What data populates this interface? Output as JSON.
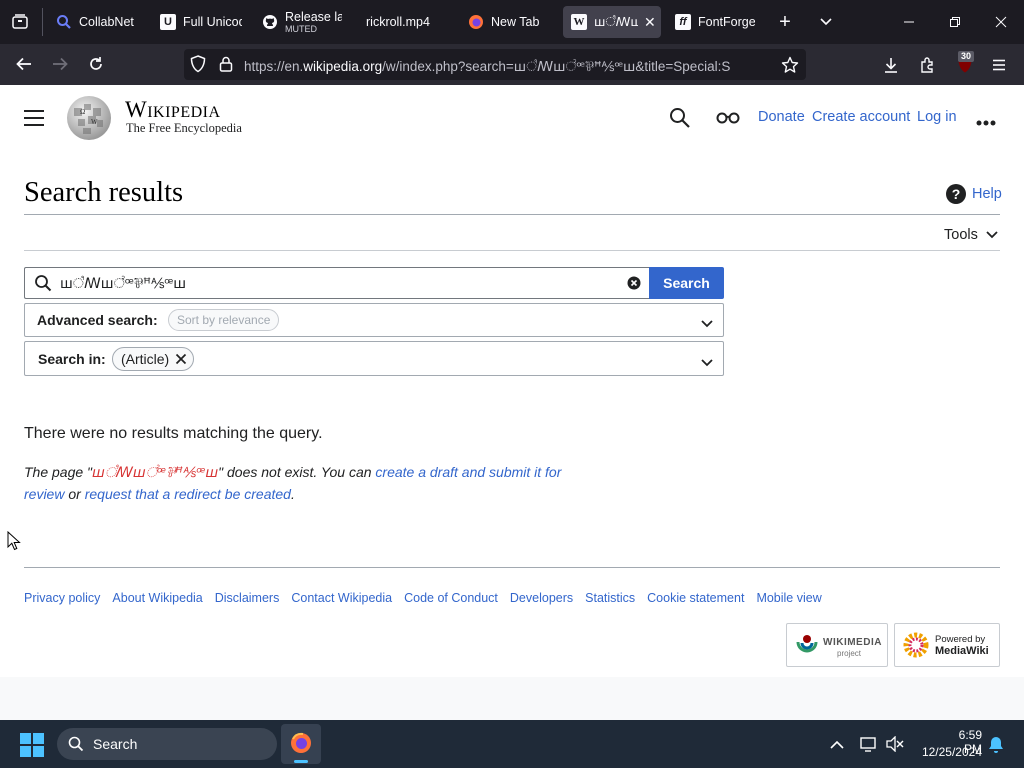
{
  "browser": {
    "tabs": [
      {
        "label": "CollabNet",
        "icon": "search-icon",
        "active": false
      },
      {
        "label": "Full Unicode",
        "icon": "unicode-favicon",
        "active": false
      },
      {
        "label": "Release lat",
        "sublabel": "MUTED",
        "icon": "github-icon",
        "active": false
      },
      {
        "label": "rickroll.mp4",
        "icon": "",
        "active": false
      },
      {
        "label": "New Tab",
        "icon": "firefox-icon",
        "active": false
      },
      {
        "label": "ꟺ꣡ꟿꟺ꣢ꟹ",
        "icon": "wikipedia-icon",
        "active": true
      },
      {
        "label": "FontForge",
        "icon": "fontforge-icon",
        "active": false
      }
    ],
    "url_prefix": "https://en.",
    "url_domain": "wikipedia.org",
    "url_suffix": "/w/index.php?search=ꟺ꣡ꟿꟺ꣢ꟹ⅌ꟸ⅍ꟹꟺ&title=Special:S",
    "extensions_badge": "30"
  },
  "wiki": {
    "wordmark": "Wikipedia",
    "tagline": "The Free Encyclopedia",
    "header_links": {
      "donate": "Donate",
      "create_account": "Create account",
      "log_in": "Log in"
    },
    "page_title": "Search results",
    "help": "Help",
    "tools": "Tools",
    "search": {
      "value": "ꟺ꣡ꟿꟺ꣢ꟹ⅌ꟸ⅍ꟹꟺ",
      "button": "Search"
    },
    "advanced": {
      "label": "Advanced search:",
      "chip": "Sort by relevance"
    },
    "search_in": {
      "label": "Search in:",
      "chip": "(Article)"
    },
    "no_results": "There were no results matching the query.",
    "not_exist": {
      "prefix": "The page \"",
      "query": "ꟺ꣡ꟿꟺ꣢ꟹ⅌ꟸ⅍ꟹꟺ",
      "middle": "\" does not exist. You can ",
      "link1": "create a draft and submit it for review",
      "or": " or ",
      "link2": "request that a redirect be created",
      "end": "."
    },
    "footer_links": [
      "Privacy policy",
      "About Wikipedia",
      "Disclaimers",
      "Contact Wikipedia",
      "Code of Conduct",
      "Developers",
      "Statistics",
      "Cookie statement",
      "Mobile view"
    ],
    "badges": {
      "wikimedia_line1": "WIKIMEDIA",
      "wikimedia_line2": "project",
      "mediawiki_line1": "Powered by",
      "mediawiki_line2": "MediaWiki"
    }
  },
  "taskbar": {
    "search_placeholder": "Search",
    "time": "6:59 PM",
    "date": "12/25/2024"
  },
  "colors": {
    "link": "#3366cc",
    "progressive": "#3366cc",
    "chrome_dark": "#1c1b22"
  }
}
